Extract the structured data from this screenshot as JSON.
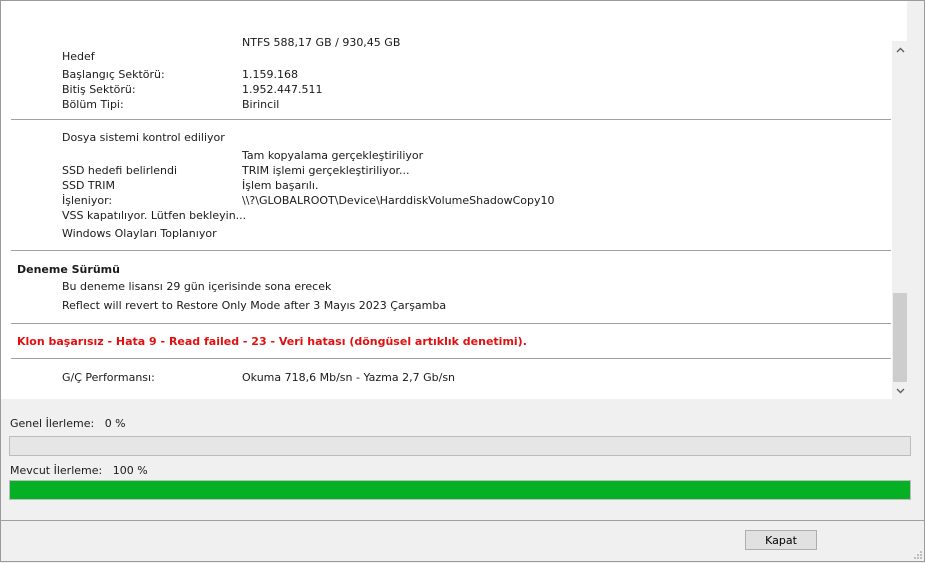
{
  "log": {
    "cut_line": "NTFS 588,17 GB / 930,45 GB",
    "target": {
      "label": "Hedef",
      "start_sector_label": "Başlangıç Sektörü:",
      "start_sector_value": "1.159.168",
      "end_sector_label": "Bitiş Sektörü:",
      "end_sector_value": "1.952.447.511",
      "partition_type_label": "Bölüm Tipi:",
      "partition_type_value": "Birincil"
    },
    "operations": {
      "fs_check": "Dosya sistemi kontrol ediliyor",
      "full_copy": "Tam kopyalama gerçekleştiriliyor",
      "ssd_target_label": "SSD hedefi belirlendi",
      "ssd_target_value": "TRIM işlemi gerçekleştiriliyor...",
      "ssd_trim_label": "SSD TRIM",
      "ssd_trim_value": "İşlem başarılı.",
      "processing_label": "İşleniyor:",
      "processing_value": "\\\\?\\GLOBALROOT\\Device\\HarddiskVolumeShadowCopy10",
      "vss_closing": "VSS kapatılıyor. Lütfen bekleyin...",
      "collecting_events": "Windows Olayları Toplanıyor"
    },
    "trial": {
      "title": "Deneme Sürümü",
      "line1": "Bu deneme lisansı 29 gün içerisinde sona erecek",
      "line2": "Reflect will revert to Restore Only Mode after 3 Mayıs 2023 Çarşamba"
    },
    "error": "Klon başarısız - Hata 9 - Read failed - 23 - Veri hatası (döngüsel artıklık denetimi).",
    "io": {
      "label": "G/Ç Performansı:",
      "value": "Okuma 718,6 Mb/sn - Yazma 2,7 Gb/sn"
    }
  },
  "progress": {
    "overall_label": "Genel İlerleme:",
    "overall_text": "0 %",
    "overall_value": 0,
    "current_label": "Mevcut İlerleme:",
    "current_text": "100 %",
    "current_value": 100,
    "fill_color": "#06b025"
  },
  "buttons": {
    "close_label": "Kapat"
  },
  "icons": {
    "scroll_up": "chevron-up-icon",
    "scroll_down": "chevron-down-icon",
    "resize": "resize-grip-icon"
  }
}
